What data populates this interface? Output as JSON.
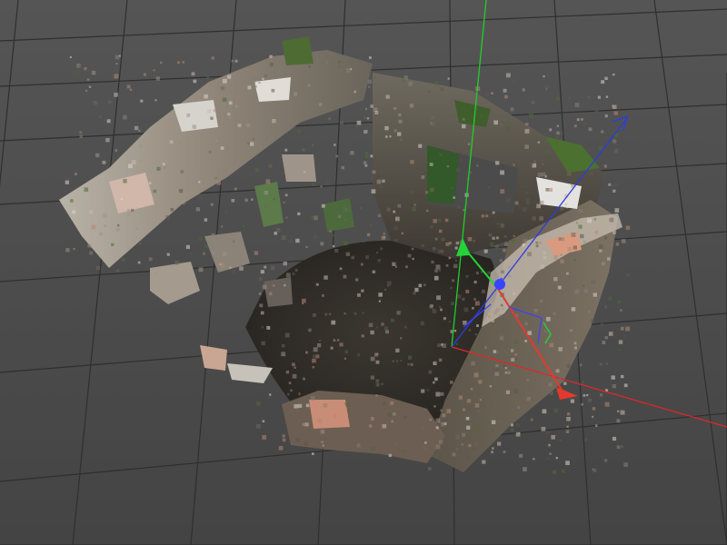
{
  "viewport": {
    "kind": "3d-viewport",
    "background_color": "#4b4b4b",
    "grid_color": "#2e2e2e"
  },
  "scene": {
    "object": "photogrammetry-point-cloud",
    "description_visible_text": ""
  },
  "axes": {
    "x": {
      "color": "#e0262a",
      "icon": "x-axis-arrow"
    },
    "y": {
      "color": "#1fcf2a",
      "icon": "y-axis-arrow"
    },
    "z": {
      "color": "#2b3de0",
      "icon": "z-axis-arrow"
    }
  },
  "gizmo": {
    "x_color": "#e23a2e",
    "y_color": "#25d23a",
    "z_color": "#3a43ff"
  }
}
